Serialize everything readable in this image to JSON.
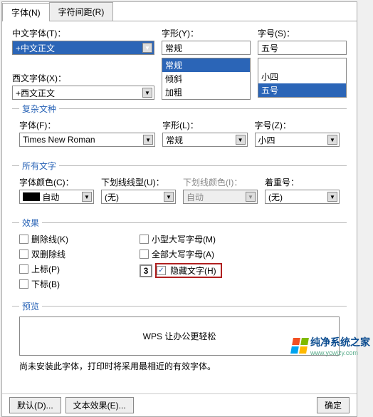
{
  "tabs": {
    "font": "字体(N)",
    "spacing": "字符间距(R)"
  },
  "section1": {
    "cn_font_label": "中文字体(T)：",
    "cn_font_value": "+中文正文",
    "style_label": "字形(Y)：",
    "style_value": "常规",
    "style_options": [
      "常规",
      "倾斜",
      "加粗"
    ],
    "size_label": "字号(S)：",
    "size_value": "五号",
    "size_options": [
      "小四",
      "五号"
    ],
    "west_font_label": "西文字体(X)：",
    "west_font_value": "+西文正文"
  },
  "complex": {
    "legend": "复杂文种",
    "font_label": "字体(F)：",
    "font_value": "Times New Roman",
    "style_label": "字形(L)：",
    "style_value": "常规",
    "size_label": "字号(Z)：",
    "size_value": "小四"
  },
  "alltext": {
    "legend": "所有文字",
    "color_label": "字体颜色(C)：",
    "color_value": "自动",
    "underline_label": "下划线线型(U)：",
    "underline_value": "(无)",
    "underline_color_label": "下划线颜色(I)：",
    "underline_color_value": "自动",
    "emphasis_label": "着重号：",
    "emphasis_value": "(无)"
  },
  "effects": {
    "legend": "效果",
    "strike": "删除线(K)",
    "dblstrike": "双删除线",
    "superscript": "上标(P)",
    "subscript": "下标(B)",
    "smallcaps": "小型大写字母(M)",
    "allcaps": "全部大写字母(A)",
    "hidden": "隐藏文字(H)",
    "annotation_num": "3"
  },
  "preview": {
    "legend": "预览",
    "text": "WPS 让办公更轻松",
    "note": "尚未安装此字体，打印时将采用最相近的有效字体。"
  },
  "buttons": {
    "default": "默认(D)...",
    "texteffect": "文本效果(E)...",
    "ok": "确定"
  },
  "watermark": {
    "brand": "纯净系统之家",
    "url": "www.ycwjzy.com"
  }
}
